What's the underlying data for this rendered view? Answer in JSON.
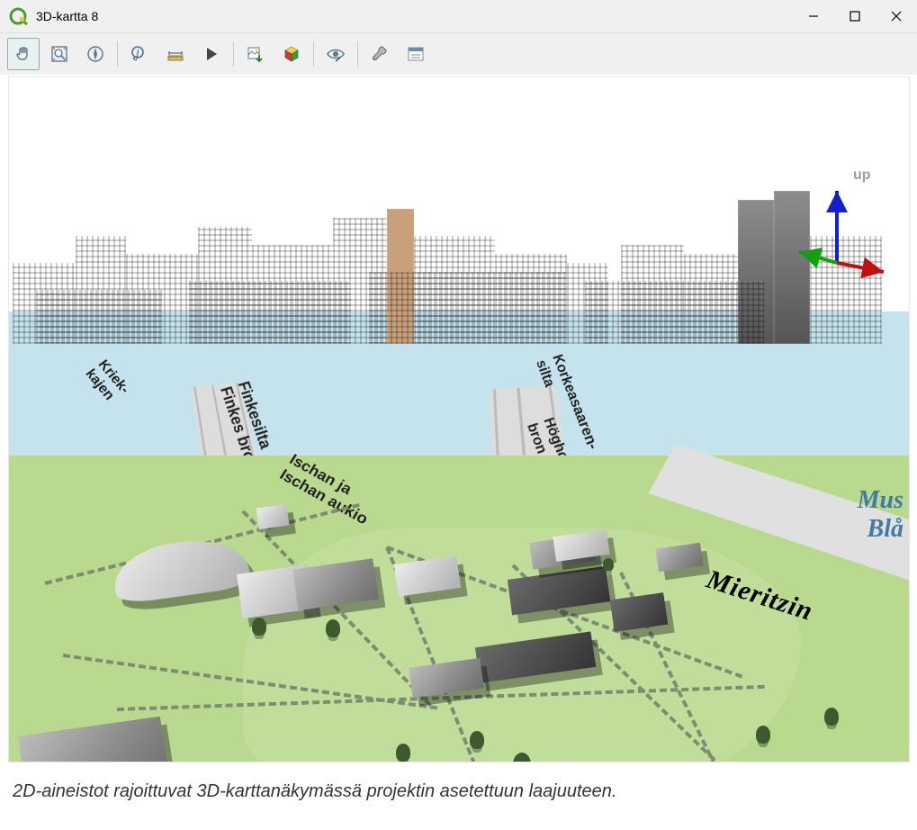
{
  "window": {
    "title": "3D-kartta 8"
  },
  "toolbar": {
    "icons": [
      "hand-icon",
      "zoom-extents-icon",
      "compass-icon",
      "identify-icon",
      "measure-icon",
      "play-icon",
      "save-image-icon",
      "cube-icon",
      "eye-icon",
      "wrench-icon",
      "options-icon"
    ]
  },
  "gizmo": {
    "up": "up"
  },
  "map": {
    "labels": {
      "isonja_aukio": "Ischan ja\nIschan aukio",
      "finkesilta": "Finkesilta\nFinkes bro",
      "korkeasaari": "Korkeasaaren-\nsilta",
      "hogholms": "Högholms-\nbron",
      "kriek": "Kriek-\nkajen",
      "mieritzin": "Mieritzin",
      "mus": "Mus",
      "bla": "Blå"
    }
  },
  "caption": "2D-aineistot rajoittuvat 3D-karttanäkymässä projektin asetettuun laajuuteen."
}
